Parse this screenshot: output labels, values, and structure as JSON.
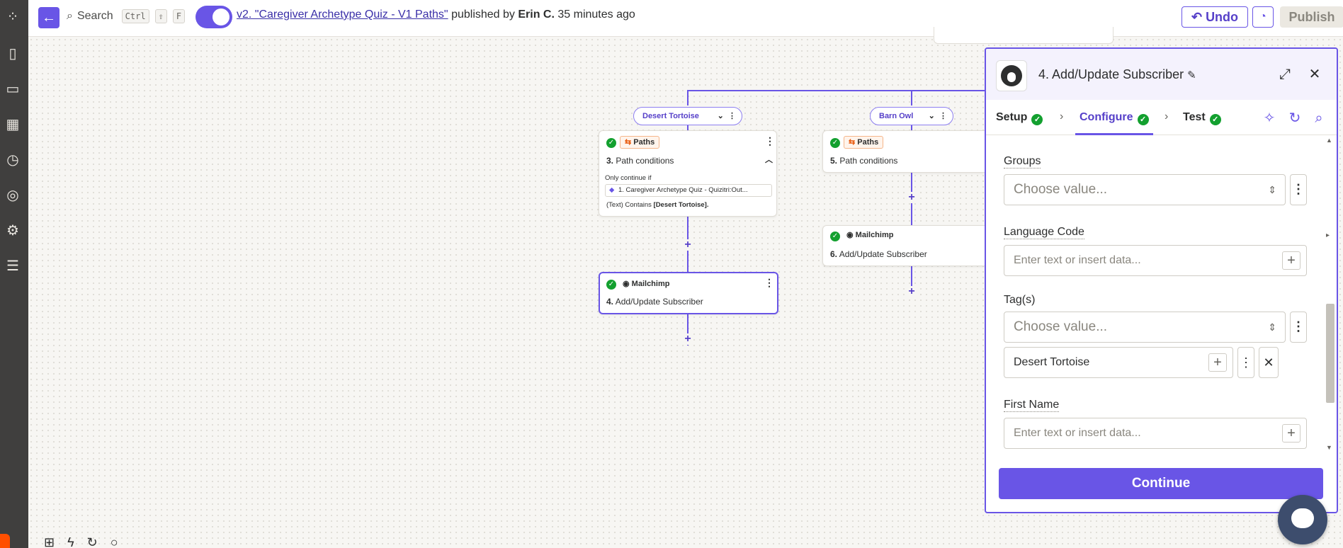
{
  "rail": {
    "icons": [
      "apps-icon",
      "zap-file-icon",
      "chat-icon",
      "calendar-icon",
      "history-icon",
      "activity-icon",
      "settings-icon",
      "layers-icon"
    ]
  },
  "topbar": {
    "search_label": "Search",
    "shortcut": [
      "Ctrl",
      "⇧",
      "F"
    ],
    "zap_name": "v2. \"Caregiver Archetype Quiz - V1 Paths\"",
    "published_by": "published by",
    "author": "Erin C.",
    "time_ago": "35 minutes ago",
    "undo_label": "Undo",
    "publish_label": "Publish"
  },
  "paths": [
    {
      "name": "Desert Tortoise"
    },
    {
      "name": "Barn Owl"
    }
  ],
  "steps": {
    "step3": {
      "tag": "Paths",
      "number": "3.",
      "title": "Path conditions",
      "only_continue": "Only continue if",
      "condition_field": "1. Caregiver Archetype Quiz - Quizitri:Out...",
      "condition_text_pre": "(Text) Contains",
      "condition_value": "[Desert Tortoise]."
    },
    "step4": {
      "tag": "Mailchimp",
      "number": "4.",
      "title": "Add/Update Subscriber"
    },
    "step5": {
      "tag": "Paths",
      "number": "5.",
      "title": "Path conditions"
    },
    "step6": {
      "tag": "Mailchimp",
      "number": "6.",
      "title": "Add/Update Subscriber"
    }
  },
  "panel": {
    "title": "4. Add/Update Subscriber",
    "tabs": [
      {
        "label": "Setup"
      },
      {
        "label": "Configure"
      },
      {
        "label": "Test"
      }
    ],
    "fields": {
      "groups": {
        "label": "Groups",
        "placeholder": "Choose value..."
      },
      "language_code": {
        "label": "Language Code",
        "placeholder": "Enter text or insert data..."
      },
      "tags": {
        "label": "Tag(s)",
        "placeholder": "Choose value...",
        "value": "Desert Tortoise"
      },
      "first_name": {
        "label": "First Name",
        "placeholder": "Enter text or insert data..."
      }
    },
    "continue_label": "Continue"
  },
  "colors": {
    "accent": "#6955e6",
    "success": "#13a02f",
    "rail": "#403f3e",
    "brand": "#ff4f00"
  }
}
